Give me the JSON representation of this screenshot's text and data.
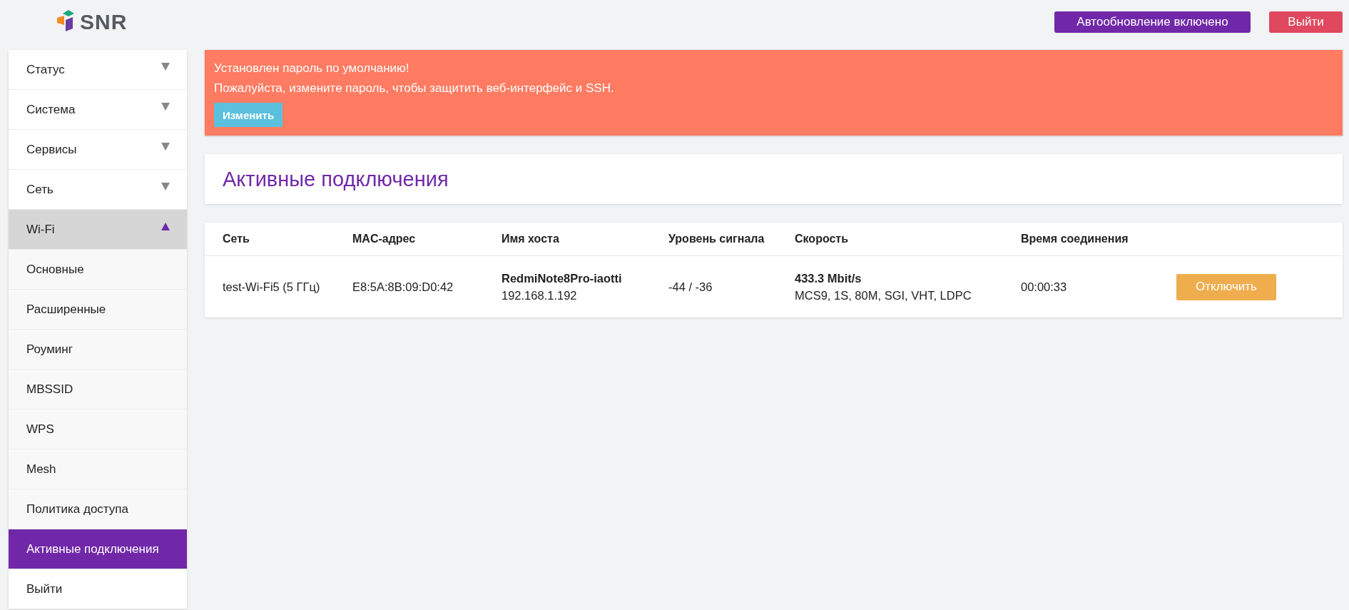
{
  "header": {
    "logo_text": "SNR",
    "buttons": [
      {
        "kind": "autoupdate",
        "label": "Автообновление включено"
      },
      {
        "kind": "logout",
        "label": "Выйти"
      }
    ]
  },
  "sidebar": {
    "items": [
      {
        "kind": "group",
        "label": "Статус",
        "expanded": false
      },
      {
        "kind": "group",
        "label": "Система",
        "expanded": false
      },
      {
        "kind": "group",
        "label": "Сервисы",
        "expanded": false
      },
      {
        "kind": "group",
        "label": "Сеть",
        "expanded": false
      },
      {
        "kind": "group",
        "label": "Wi-Fi",
        "expanded": true,
        "children": [
          {
            "label": "Основные",
            "selected": false
          },
          {
            "label": "Расширенные",
            "selected": false
          },
          {
            "label": "Роуминг",
            "selected": false
          },
          {
            "label": "MBSSID",
            "selected": false
          },
          {
            "label": "WPS",
            "selected": false
          },
          {
            "label": "Mesh",
            "selected": false
          },
          {
            "label": "Политика доступа",
            "selected": false
          },
          {
            "label": "Активные подключения",
            "selected": true
          }
        ]
      },
      {
        "kind": "link",
        "label": "Выйти",
        "expanded": false
      }
    ]
  },
  "alert": {
    "lines": [
      "Установлен пароль по умолчанию!",
      "Пожалуйста, измените пароль, чтобы защитить веб-интерфейс и SSH."
    ],
    "button": "Изменить"
  },
  "page_title": "Активные подключения",
  "table": {
    "columns": [
      "Сеть",
      "MAC-адрес",
      "Имя хоста",
      "Уровень сигнала",
      "Скорость",
      "Время соединения"
    ],
    "rows": [
      {
        "network": "test-Wi-Fi5 (5 ГГц)",
        "mac": "E8:5A:8B:09:D0:42",
        "hostname": "RedmiNote8Pro-iaotti",
        "ip": "192.168.1.192",
        "signal": "-44 / -36",
        "rate": "433.3 Mbit/s",
        "rate_details": "MCS9, 1S, 80M, SGI, VHT, LDPC",
        "time": "00:00:33",
        "action": "Отключить"
      }
    ]
  }
}
